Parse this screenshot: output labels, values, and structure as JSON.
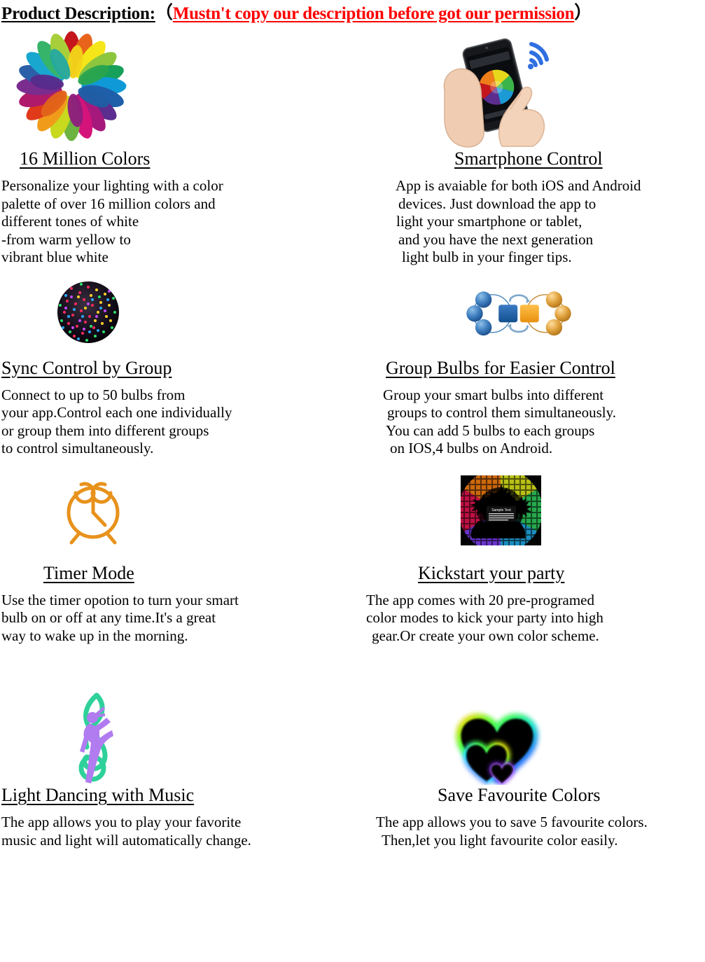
{
  "header": {
    "label": "Product Description:",
    "paren_open": "（",
    "warning": "Mustn't copy our description before got our permission",
    "paren_close": "）",
    "warning_color": "#ff0000"
  },
  "sections": [
    {
      "id": "16-million-colors",
      "image": "color-pinwheel-image",
      "title": "16 Million Colors",
      "title_underlined": true,
      "lines": [
        "Personalize your lighting with a color",
        "palette of over 16 million colors and",
        "different tones of white",
        "-from warm yellow to",
        "vibrant blue white"
      ]
    },
    {
      "id": "smartphone-control",
      "image": "smartphone-in-hand-image",
      "title": "Smartphone Control",
      "title_underlined": true,
      "lines": [
        "App is avaiable for both iOS and Android",
        "devices. Just download the app to",
        "light your smartphone or tablet,",
        "and you have the next generation",
        "light bulb in your finger tips."
      ]
    },
    {
      "id": "sync-control-by-group",
      "image": "dotted-sphere-image",
      "title": "Sync Control by Group",
      "title_underlined": true,
      "lines": [
        "Connect to up to 50 bulbs from",
        "your app.Control each one individually",
        "or group them into different groups",
        "to control simultaneously."
      ]
    },
    {
      "id": "group-bulbs-for-easier-control",
      "image": "group-network-diagram-image",
      "title": "Group Bulbs for Easier Control",
      "title_underlined": true,
      "lines": [
        "Group your smart bulbs into different",
        "groups to control them simultaneously.",
        "You can add 5 bulbs to each groups",
        "on IOS,4 bulbs on Android."
      ]
    },
    {
      "id": "timer-mode",
      "image": "alarm-clock-icon",
      "title": "Timer Mode",
      "title_underlined": true,
      "lines": [
        "Use the timer opotion to turn your smart",
        "bulb on or off at any time.It's a great",
        "way to wake up in the morning."
      ]
    },
    {
      "id": "kickstart-your-party",
      "image": "party-poster-image",
      "title": "Kickstart your party",
      "title_underlined": true,
      "lines": [
        "The app comes with 20 pre-programed",
        "color modes to kick your party into high",
        "gear.Or create your own color scheme."
      ]
    },
    {
      "id": "light-dancing-with-music",
      "image": "music-clef-dancer-image",
      "title": "Light Dancing with Music",
      "title_underlined": true,
      "lines": [
        "The app allows you to play your favorite",
        "music and light will automatically change."
      ]
    },
    {
      "id": "save-favourite-colors",
      "image": "neon-heart-image",
      "title": "Save Favourite Colors",
      "title_underlined": false,
      "lines": [
        "The app allows you to save 5 favourite colors.",
        "Then,let you light favourite color easily."
      ]
    }
  ],
  "palette": {
    "blue_node": "#2e75b6",
    "orange_node": "#e09a2e",
    "blue_square": "#1f5fa9",
    "orange_square": "#f0a020",
    "clock_orange": "#e8921c",
    "clef_green": "#2fd19a",
    "dancer_purple": "#b07cf0"
  }
}
